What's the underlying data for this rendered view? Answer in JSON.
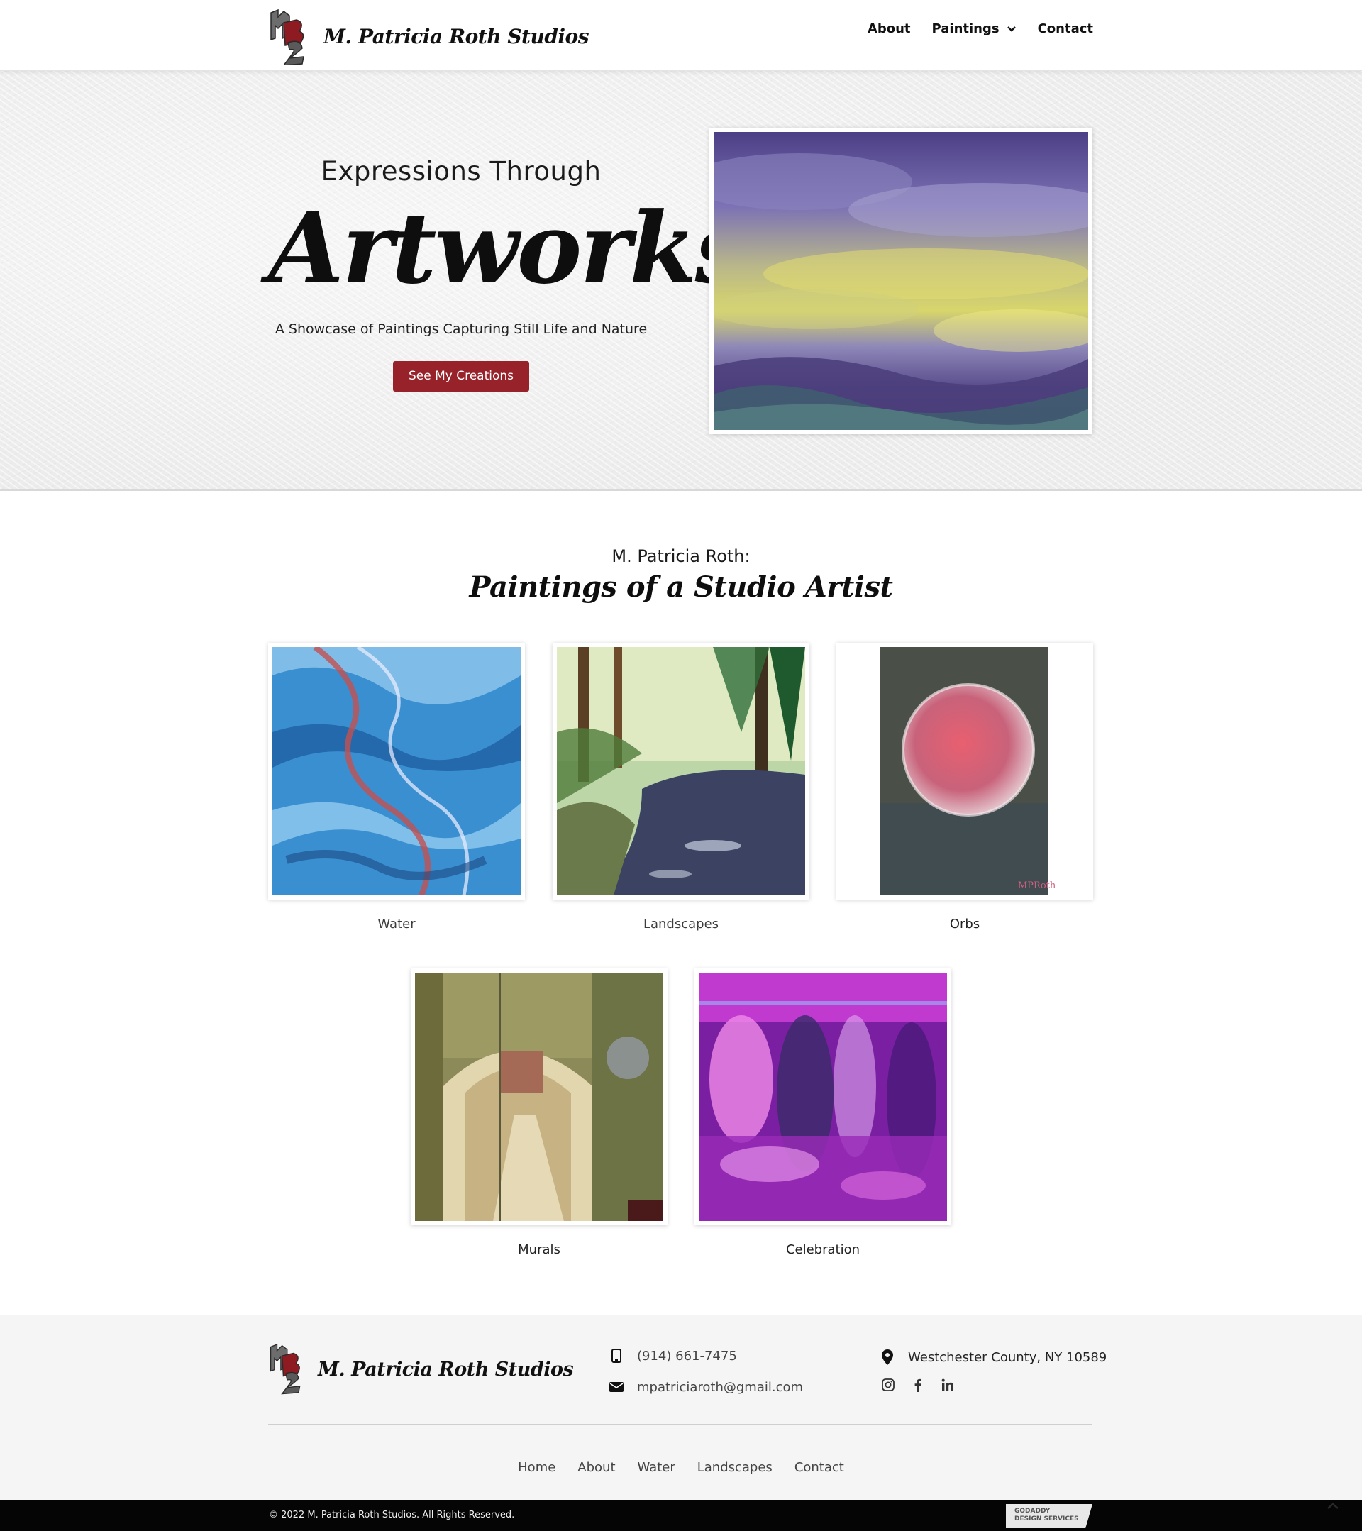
{
  "header": {
    "brand": "M. Patricia Roth Studios",
    "nav": [
      {
        "label": "About"
      },
      {
        "label": "Paintings"
      },
      {
        "label": "Contact"
      }
    ]
  },
  "hero": {
    "kicker": "Expressions Through",
    "title": "Artworks",
    "subtitle": "A Showcase of Paintings Capturing Still Life and Nature",
    "button": "See My Creations"
  },
  "intro": {
    "kicker": "M. Patricia Roth:",
    "title": "Paintings of a Studio Artist"
  },
  "gallery": [
    {
      "label": "Water"
    },
    {
      "label": "Landscapes"
    },
    {
      "label": "Orbs"
    },
    {
      "label": "Murals"
    },
    {
      "label": "Celebration"
    }
  ],
  "footer": {
    "brand": "M. Patricia Roth Studios",
    "phone": "(914) 661-7475",
    "email": "mpatriciaroth@gmail.com",
    "location": "Westchester County, NY 10589",
    "social": [
      "instagram-icon",
      "facebook-icon",
      "linkedin-icon"
    ],
    "nav": [
      "Home",
      "About",
      "Water",
      "Landscapes",
      "Contact"
    ],
    "copyright": "© 2022 M. Patricia Roth Studios. All Rights Reserved.",
    "badge_line1": "GODADDY",
    "badge_line2": "DESIGN SERVICES"
  },
  "colors": {
    "accent": "#97222a",
    "footer_bg": "#f5f5f5",
    "bottom_bar": "#050505"
  }
}
